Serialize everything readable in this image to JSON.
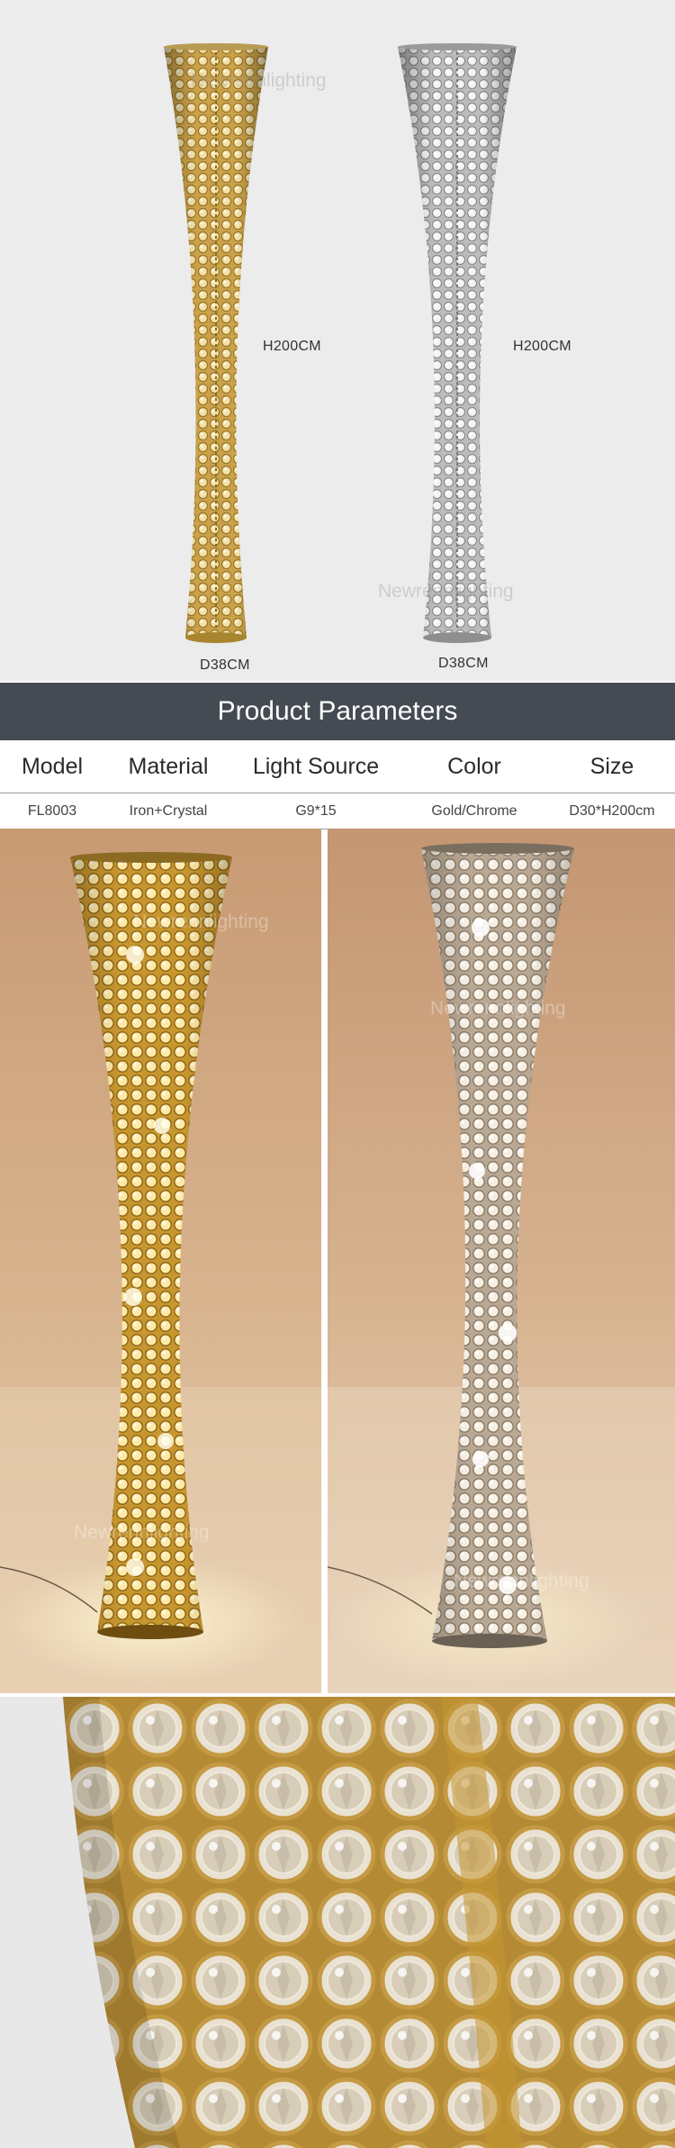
{
  "dimension_photo": {
    "lamps": [
      {
        "finish": "gold",
        "height_label": "H200CM",
        "diameter_label": "D38CM"
      },
      {
        "finish": "chrome",
        "height_label": "H200CM",
        "diameter_label": "D38CM"
      }
    ],
    "watermark": "Newrennlighting"
  },
  "parameters": {
    "banner_title": "Product Parameters",
    "headers": [
      "Model",
      "Material",
      "Light Source",
      "Color",
      "Size"
    ],
    "values": [
      "FL8003",
      "Iron+Crystal",
      "G9*15",
      "Gold/Chrome",
      "D30*H200cm"
    ]
  },
  "photos": {
    "watermark": "Newrennlighting"
  },
  "colors": {
    "banner_bg": "#454b53",
    "gold": "#d9b55a",
    "chrome": "#d8d8d8",
    "wall_warm": "#d9b48e",
    "background_grey": "#ececec"
  }
}
